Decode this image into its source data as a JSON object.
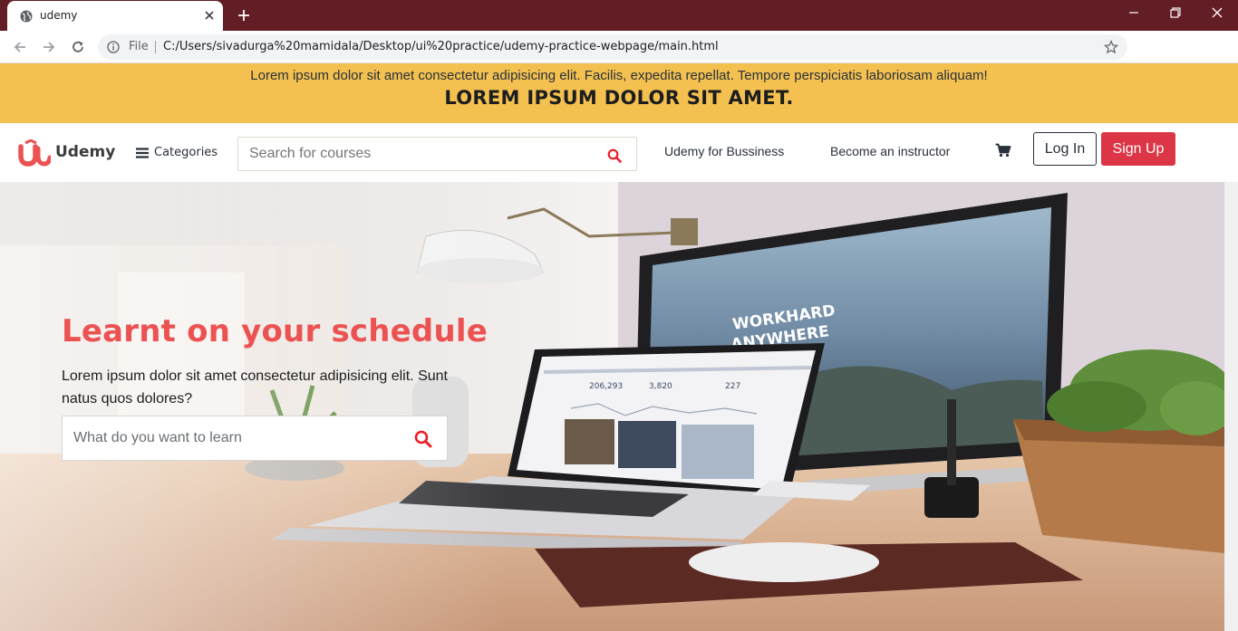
{
  "browser": {
    "tab_title": "udemy",
    "file_label": "File",
    "url": "C:/Users/sivadurga%20mamidala/Desktop/ui%20practice/udemy-practice-webpage/main.html"
  },
  "banner": {
    "text": "Lorem ipsum dolor sit amet consectetur adipisicing elit. Facilis, expedita repellat. Tempore perspiciatis laboriosam aliquam!",
    "heading": "LOREM IPSUM DOLOR SIT AMET."
  },
  "header": {
    "logo_text": "Udemy",
    "categories_label": "Categories",
    "search_placeholder": "Search for courses",
    "business_link": "Udemy for Bussiness",
    "instructor_link": "Become an instructor",
    "login_label": "Log In",
    "signup_label": "Sign Up"
  },
  "hero": {
    "title": "Learnt on your schedule",
    "subtitle": "Lorem ipsum dolor sit amet consectetur adipisicing elit. Sunt natus quos dolores?",
    "search_placeholder": "What do you want to learn",
    "monitor_text_line1": "WORKHARD",
    "monitor_text_line2": "ANYWHERE"
  },
  "icons": {
    "tab_favicon": "globe-icon",
    "tab_close": "close-icon",
    "new_tab": "plus-icon",
    "back": "back-arrow-icon",
    "forward": "forward-arrow-icon",
    "reload": "reload-icon",
    "info": "info-icon",
    "bookmark": "star-icon",
    "menu": "hamburger-icon",
    "search": "search-icon",
    "cart": "cart-icon"
  },
  "colors": {
    "titlebar": "#631d24",
    "banner": "#f4c150",
    "brand_red": "#ec5252",
    "signup_button": "#dc3545",
    "text_dark": "#29303b"
  }
}
